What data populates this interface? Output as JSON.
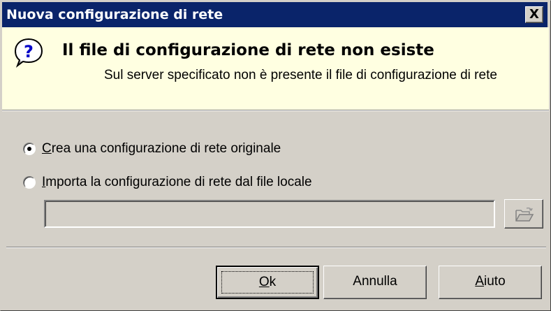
{
  "window": {
    "title": "Nuova configurazione di rete",
    "close_label": "X"
  },
  "banner": {
    "icon": "question-icon",
    "title": "Il file di configurazione di rete non esiste",
    "subtitle": "Sul server specificato non è presente il file di configurazione di rete"
  },
  "options": {
    "create": {
      "accel": "C",
      "rest": "rea una configurazione di rete originale",
      "checked": true
    },
    "import": {
      "accel": "I",
      "rest": "mporta la configurazione di rete dal file locale",
      "checked": false
    },
    "file_path_value": "",
    "browse_icon": "open-folder-icon"
  },
  "buttons": {
    "ok": {
      "accel": "O",
      "rest": "k"
    },
    "cancel": {
      "label": "Annulla"
    },
    "help": {
      "accel": "A",
      "rest": "iuto"
    }
  },
  "colors": {
    "titlebar": "#0a246a",
    "banner": "#ffffe1",
    "face": "#d4d0c8"
  }
}
